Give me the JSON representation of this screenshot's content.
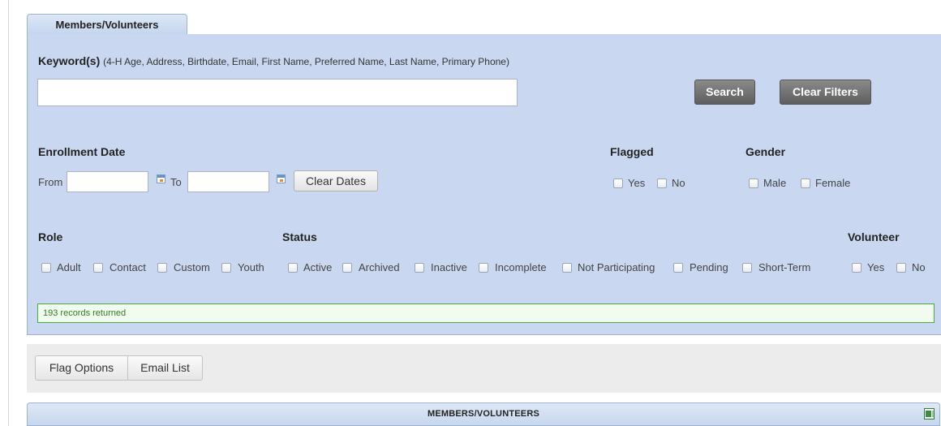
{
  "tab": {
    "label": "Members/Volunteers"
  },
  "keyword": {
    "label": "Keyword(s)",
    "hint": "(4-H Age, Address, Birthdate, Email, First Name, Preferred Name, Last Name, Primary Phone)",
    "value": ""
  },
  "buttons": {
    "search": "Search",
    "clear_filters": "Clear Filters",
    "clear_dates": "Clear Dates"
  },
  "enrollment": {
    "title": "Enrollment Date",
    "from": "From",
    "to": "To",
    "from_value": "",
    "to_value": ""
  },
  "flagged": {
    "title": "Flagged",
    "options": [
      "Yes",
      "No"
    ]
  },
  "gender": {
    "title": "Gender",
    "options": [
      "Male",
      "Female"
    ]
  },
  "role": {
    "title": "Role",
    "options": [
      "Adult",
      "Contact",
      "Custom",
      "Youth"
    ]
  },
  "status": {
    "title": "Status",
    "options": [
      "Active",
      "Archived",
      "Inactive",
      "Incomplete",
      "Not Participating",
      "Pending",
      "Short-Term"
    ]
  },
  "volunteer": {
    "title": "Volunteer",
    "options": [
      "Yes",
      "No"
    ]
  },
  "result": {
    "text": "193 records returned"
  },
  "toolbar": {
    "flag_options": "Flag Options",
    "email_list": "Email List"
  },
  "grid": {
    "title": "MEMBERS/VOLUNTEERS",
    "export_icon": "excel-export-icon"
  }
}
